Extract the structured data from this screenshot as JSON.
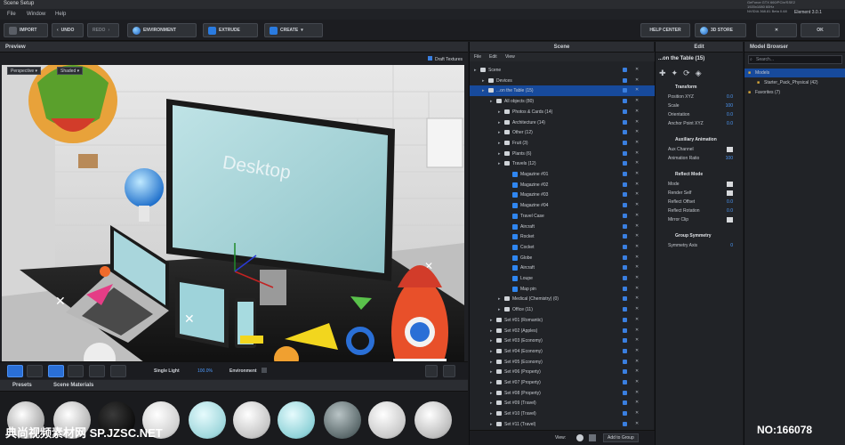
{
  "window": {
    "title": "Scene Setup",
    "gpu_info": [
      "GeForce GTX 660/PCIe/SSE2",
      "1920x1080 60Hz",
      "NVIDIA 368.81 Beta 0.68"
    ],
    "element_tag": "Element  3.0.1"
  },
  "menu": [
    "File",
    "Window",
    "Help"
  ],
  "toolbar": {
    "import": "IMPORT",
    "undo": "UNDO",
    "redo": "REDO",
    "environment": "ENVIRONMENT",
    "extrude": "EXTRUDE",
    "create": "CREATE",
    "help_center": "HELP CENTER",
    "store": "3D STORE",
    "ok": "OK"
  },
  "preview": {
    "title": "Preview",
    "camera": "Perspective",
    "shading": "Shaded",
    "draft_textures": "Draft Textures",
    "monitor_text": "Desktop",
    "light_mode": "Single Light",
    "zoom": "100.0%",
    "environment": "Environment"
  },
  "materials": {
    "tabs": [
      "Presets",
      "Scene Materials"
    ]
  },
  "scene": {
    "title": "Scene",
    "menu": [
      "File",
      "Edit",
      "View"
    ],
    "rows": [
      {
        "label": "Scene",
        "indent": 0,
        "kind": "root"
      },
      {
        "label": "Devices",
        "indent": 1,
        "kind": "folder"
      },
      {
        "label": "...on the Table (15)",
        "indent": 1,
        "kind": "folder",
        "selected": true
      },
      {
        "label": "All objects (80)",
        "indent": 2,
        "kind": "folder"
      },
      {
        "label": "Photos & Cards (14)",
        "indent": 3,
        "kind": "folder"
      },
      {
        "label": "Architecture (14)",
        "indent": 3,
        "kind": "folder"
      },
      {
        "label": "Other (12)",
        "indent": 3,
        "kind": "folder"
      },
      {
        "label": "Fruit (3)",
        "indent": 3,
        "kind": "folder"
      },
      {
        "label": "Plants (6)",
        "indent": 3,
        "kind": "folder"
      },
      {
        "label": "Travels (12)",
        "indent": 3,
        "kind": "folder"
      },
      {
        "label": "Magazine #01",
        "indent": 4,
        "kind": "item"
      },
      {
        "label": "Magazine #02",
        "indent": 4,
        "kind": "item"
      },
      {
        "label": "Magazine #03",
        "indent": 4,
        "kind": "item"
      },
      {
        "label": "Magazine #04",
        "indent": 4,
        "kind": "item"
      },
      {
        "label": "Travel Case",
        "indent": 4,
        "kind": "item"
      },
      {
        "label": "Aircraft",
        "indent": 4,
        "kind": "item"
      },
      {
        "label": "Rocket",
        "indent": 4,
        "kind": "item"
      },
      {
        "label": "Cocket",
        "indent": 4,
        "kind": "item"
      },
      {
        "label": "Globe",
        "indent": 4,
        "kind": "item"
      },
      {
        "label": "Aircraft",
        "indent": 4,
        "kind": "item"
      },
      {
        "label": "Loupe",
        "indent": 4,
        "kind": "item"
      },
      {
        "label": "Map pin",
        "indent": 4,
        "kind": "item"
      },
      {
        "label": "Medical (Chemistry) (0)",
        "indent": 3,
        "kind": "folder"
      },
      {
        "label": "Office (11)",
        "indent": 3,
        "kind": "folder"
      },
      {
        "label": "Set #01 (Romantic)",
        "indent": 2,
        "kind": "folder"
      },
      {
        "label": "Set #02 (Apples)",
        "indent": 2,
        "kind": "folder"
      },
      {
        "label": "Set #03 (Economy)",
        "indent": 2,
        "kind": "folder"
      },
      {
        "label": "Set #04 (Economy)",
        "indent": 2,
        "kind": "folder"
      },
      {
        "label": "Set #05 (Economy)",
        "indent": 2,
        "kind": "folder"
      },
      {
        "label": "Set #06 (Property)",
        "indent": 2,
        "kind": "folder"
      },
      {
        "label": "Set #07 (Property)",
        "indent": 2,
        "kind": "folder"
      },
      {
        "label": "Set #08 (Property)",
        "indent": 2,
        "kind": "folder"
      },
      {
        "label": "Set #09 (Travel)",
        "indent": 2,
        "kind": "folder"
      },
      {
        "label": "Set #10 (Travel)",
        "indent": 2,
        "kind": "folder"
      },
      {
        "label": "Set #11 (Travel)",
        "indent": 2,
        "kind": "folder"
      }
    ],
    "view_label": "View:",
    "add_to_group": "Add to Group"
  },
  "edit": {
    "title": "Edit",
    "object_name": "...on the Table (15)",
    "sections": [
      {
        "header": "Transform",
        "fields": [
          [
            "Position XYZ",
            "0.0"
          ],
          [
            "Scale",
            "100"
          ],
          [
            "Orientation",
            "0.0"
          ],
          [
            "Anchor Point XYZ",
            "0.0"
          ]
        ]
      },
      {
        "header": "Auxiliary Animation",
        "fields": [
          [
            "Aux Channel",
            ""
          ],
          [
            "Animation Ratio",
            "100"
          ]
        ]
      },
      {
        "header": "Reflect Mode",
        "fields": [
          [
            "Mode",
            ""
          ],
          [
            "Render Self",
            ""
          ],
          [
            "Reflect Offset",
            "0.0"
          ],
          [
            "Reflect Rotation",
            "0.0"
          ],
          [
            "Mirror Clip",
            ""
          ]
        ]
      },
      {
        "header": "Group Symmetry",
        "fields": [
          [
            "Symmetry Axis",
            "0"
          ]
        ]
      }
    ]
  },
  "browser": {
    "title": "Model Browser",
    "search_placeholder": "Search...",
    "tree": [
      {
        "label": "Models",
        "indent": 0
      },
      {
        "label": "Starter_Pack_Physical (42)",
        "indent": 1
      },
      {
        "label": "Favorites (7)",
        "indent": 0
      }
    ]
  },
  "watermark": {
    "left": "典尚视频素材网 SP.JZSC.NET",
    "right": "NO:166078"
  },
  "colors": {
    "accent": "#2f86f0",
    "selected": "#174a9c",
    "panel": "#212327"
  }
}
